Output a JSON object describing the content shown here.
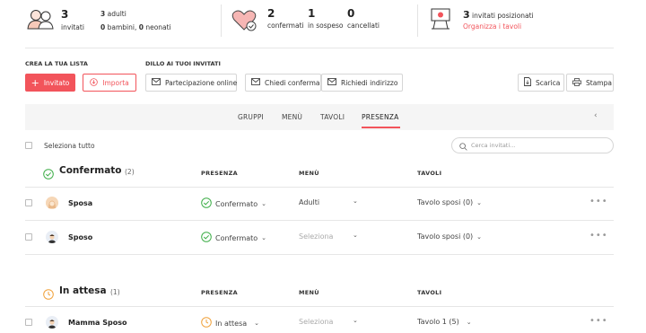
{
  "stats": {
    "invited": {
      "count": "3",
      "label": "invitati",
      "adults_count": "3",
      "adults_label": "adulti",
      "children_count": "0",
      "children_label": "bambini,",
      "infants_count": "0",
      "infants_label": "neonati"
    },
    "rsvp": {
      "confirmed_count": "2",
      "confirmed_label": "confermati",
      "pending_count": "1",
      "pending_label": "in sospeso",
      "cancelled_count": "0",
      "cancelled_label": "cancellati"
    },
    "seating": {
      "count": "3",
      "label": "invitati posizionati",
      "link": "Organizza i tavoli"
    }
  },
  "toolbar": {
    "create_title": "CREA LA TUA LISTA",
    "invite_title": "DILLO AI TUOI INVITATI",
    "add_invited": "Invitato",
    "import": "Importa",
    "online": "Partecipazione online",
    "ask_confirm": "Chiedi conferma",
    "ask_address": "Richiedi indirizzo",
    "download": "Scarica",
    "print": "Stampa"
  },
  "tabs": [
    "GRUPPI",
    "MENÙ",
    "TAVOLI",
    "PRESENZA"
  ],
  "active_tab": "PRESENZA",
  "select_all": "Seleziona tutto",
  "search": {
    "placeholder": "Cerca invitati..."
  },
  "groups": [
    {
      "title": "Confermato",
      "count": "(2)",
      "headers": {
        "presence": "PRESENZA",
        "menu": "MENÙ",
        "tables": "TAVOLI"
      },
      "guests": [
        {
          "name": "Sposa",
          "presence": "Confermato",
          "menu": "Adulti",
          "table": "Tavolo sposi (0)"
        },
        {
          "name": "Sposo",
          "presence": "Confermato",
          "menu": "Seleziona",
          "table": "Tavolo sposi (0)"
        }
      ]
    },
    {
      "title": "In attesa",
      "count": "(1)",
      "headers": {
        "presence": "PRESENZA",
        "menu": "MENÙ",
        "tables": "TAVOLI"
      },
      "guests": [
        {
          "name": "Mamma Sposo",
          "presence": "In attesa",
          "menu": "Seleziona",
          "table": "Tavolo 1 (5)"
        }
      ]
    }
  ],
  "more": "•••",
  "colors": {
    "accent": "#f2545b",
    "confirmed": "#3fae49",
    "pending": "#f0a23c"
  }
}
